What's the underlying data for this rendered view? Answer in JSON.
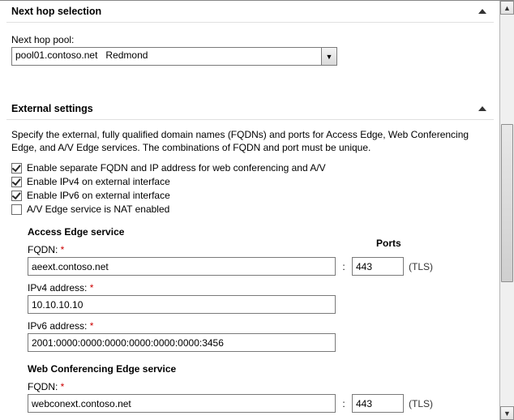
{
  "nextHop": {
    "sectionTitle": "Next hop selection",
    "poolLabel": "Next hop pool:",
    "poolValue": "pool01.contoso.net   Redmond"
  },
  "external": {
    "sectionTitle": "External settings",
    "description": "Specify the external, fully qualified domain names (FQDNs) and ports for Access Edge, Web Conferencing Edge, and A/V Edge services. The combinations of FQDN and port must be unique.",
    "chkSeparate": "Enable separate FQDN and IP address for web conferencing and A/V",
    "chkIPv4": "Enable IPv4 on external interface",
    "chkIPv6": "Enable IPv6 on external interface",
    "chkNat": "A/V Edge service is NAT enabled",
    "portsHeader": "Ports",
    "access": {
      "title": "Access Edge service",
      "fqdnLabel": "FQDN:",
      "fqdnValue": "aeext.contoso.net",
      "portValue": "443",
      "protocol": "(TLS)",
      "ipv4Label": "IPv4 address:",
      "ipv4Value": "10.10.10.10",
      "ipv6Label": "IPv6 address:",
      "ipv6Value": "2001:0000:0000:0000:0000:0000:0000:3456"
    },
    "webconf": {
      "title": "Web Conferencing Edge service",
      "fqdnLabel": "FQDN:",
      "fqdnValue": "webconext.contoso.net",
      "portValue": "443",
      "protocol": "(TLS)"
    }
  },
  "requiredMark": " *"
}
